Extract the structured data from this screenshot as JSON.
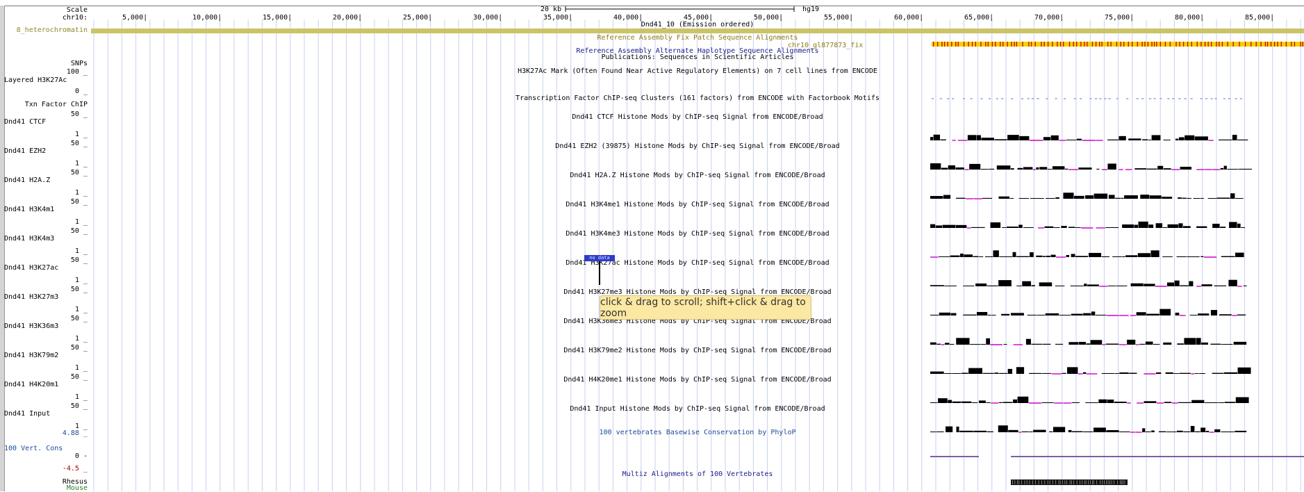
{
  "ruler": {
    "scale_label": "Scale",
    "chrom_label": "chr10:",
    "scale_bar_label": "20 kb",
    "assembly": "hg19",
    "positions": [
      "5,000|",
      "10,000|",
      "15,000|",
      "20,000|",
      "25,000|",
      "30,000|",
      "35,000|",
      "40,000|",
      "45,000|",
      "50,000|",
      "55,000|",
      "60,000|",
      "65,000|",
      "70,000|",
      "75,000|",
      "80,000|",
      "85,000|"
    ],
    "chromhmm_title": "Dnd41_10 (Emission ordered)"
  },
  "left_labels": {
    "heterochromatin": "8_heterochromatin",
    "snps": "SNPs",
    "layered_scale_max": "100 _",
    "layered_label": "Layered H3K27Ac",
    "layered_scale_min": "0 _",
    "txn_label": "Txn Factor ChIP",
    "cons_max": "4.88 _",
    "cons_label": "100 Vert. Cons",
    "cons_zero": "0 -",
    "cons_min": "-4.5 _",
    "rhesus": "Rhesus",
    "mouse": "Mouse"
  },
  "track_titles": {
    "fix_patch": "Reference Assembly Fix Patch Sequence Alignments",
    "fix_patch_item": "chr10_gl877873_fix",
    "alt_haplotype": "Reference Assembly Alternate Haplotype Sequence Alignments",
    "publications": "Publications: Sequences in Scientific Articles",
    "h3k27ac_mark": "H3K27Ac Mark (Often Found Near Active Regulatory Elements) on 7 cell lines from ENCODE",
    "tfbs": "Transcription Factor ChIP-seq Clusters (161 factors) from ENCODE with Factorbook Motifs",
    "cons": "100 vertebrates Basewise Conservation by PhyloP",
    "multiz": "Multiz Alignments of 100 Vertebrates"
  },
  "histone_tracks": [
    {
      "label": "Dnd41 CTCF",
      "title": "Dnd41 CTCF Histone Mods by ChIP-seq Signal from ENCODE/Broad",
      "scale_top": "50 _",
      "scale_bottom": "1 _"
    },
    {
      "label": "Dnd41 EZH2",
      "title": "Dnd41 EZH2 (39875) Histone Mods by ChIP-seq Signal from ENCODE/Broad",
      "scale_top": "50 _",
      "scale_bottom": "1 _"
    },
    {
      "label": "Dnd41 H2A.Z",
      "title": "Dnd41 H2A.Z Histone Mods by ChIP-seq Signal from ENCODE/Broad",
      "scale_top": "50 _",
      "scale_bottom": "1 _"
    },
    {
      "label": "Dnd41 H3K4m1",
      "title": "Dnd41 H3K4me1 Histone Mods by ChIP-seq Signal from ENCODE/Broad",
      "scale_top": "50 _",
      "scale_bottom": "1 _"
    },
    {
      "label": "Dnd41 H3K4m3",
      "title": "Dnd41 H3K4me3 Histone Mods by ChIP-seq Signal from ENCODE/Broad",
      "scale_top": "50 _",
      "scale_bottom": "1 _"
    },
    {
      "label": "Dnd41 H3K27ac",
      "title": "Dnd41 H3K27ac Histone Mods by ChIP-seq Signal from ENCODE/Broad",
      "scale_top": "50 _",
      "scale_bottom": "1 _"
    },
    {
      "label": "Dnd41 H3K27m3",
      "title": "Dnd41 H3K27me3 Histone Mods by ChIP-seq Signal from ENCODE/Broad",
      "scale_top": "50 _",
      "scale_bottom": "1 _"
    },
    {
      "label": "Dnd41 H3K36m3",
      "title": "Dnd41 H3K36me3 Histone Mods by ChIP-seq Signal from ENCODE/Broad",
      "scale_top": "50 _",
      "scale_bottom": "1 _"
    },
    {
      "label": "Dnd41 H3K79m2",
      "title": "Dnd41 H3K79me2 Histone Mods by ChIP-seq Signal from ENCODE/Broad",
      "scale_top": "50 _",
      "scale_bottom": "1 _"
    },
    {
      "label": "Dnd41 H4K20m1",
      "title": "Dnd41 H4K20me1 Histone Mods by ChIP-seq Signal from ENCODE/Broad",
      "scale_top": "50 _",
      "scale_bottom": "1 _"
    },
    {
      "label": "Dnd41 Input",
      "title": "Dnd41 Input Histone Mods by ChIP-seq Signal from ENCODE/Broad",
      "scale_top": "50 _",
      "scale_bottom": "1 _"
    }
  ],
  "overlays": {
    "no_data_label": "no data",
    "drag_hint": "click & drag to scroll; shift+click & drag to zoom"
  },
  "colors": {
    "heterochromatin": "#c9c46a",
    "fix_patch_title": "#8c7a17",
    "alt_haplotype_title": "#1a1a8c",
    "cons_title": "#1a4a99",
    "signal_fill": "#000000",
    "gap_marker": "#cc00cc",
    "fix_patch_item_bg": "#f5d100",
    "fix_patch_item_stripe": "#cc0000",
    "gridline": "#c8d0ee"
  }
}
